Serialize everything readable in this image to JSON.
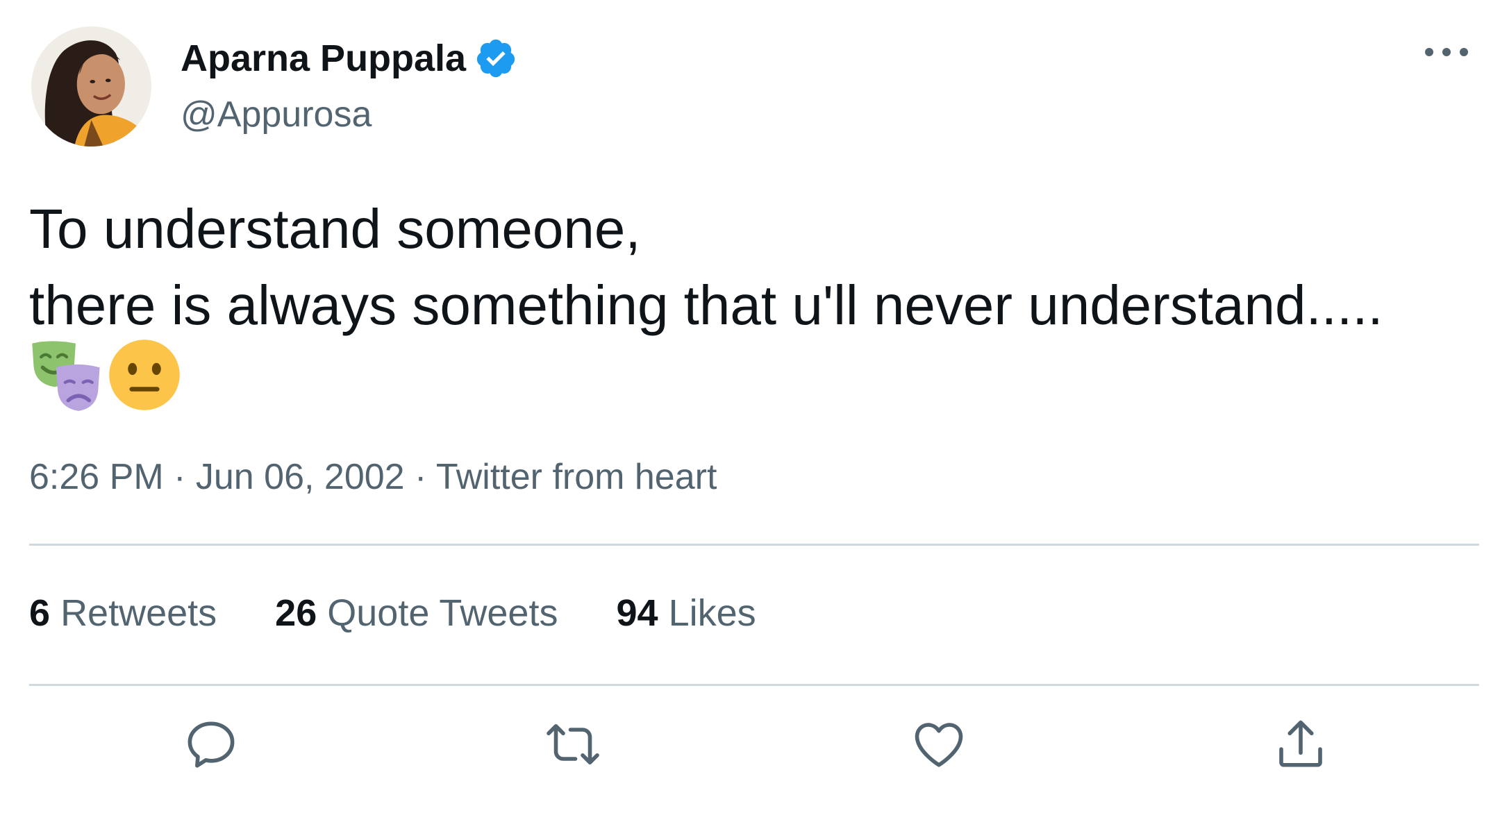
{
  "author": {
    "display_name": "Aparna Puppala",
    "handle": "@Appurosa",
    "verified": true,
    "avatar_icon": "avatar-photo"
  },
  "tweet": {
    "lines": [
      "To understand someone,",
      "there is always something that u'll never understand....."
    ],
    "emojis": [
      "performing-arts",
      "neutral-face"
    ]
  },
  "meta": {
    "time": "6:26 PM",
    "date": "Jun 06, 2002",
    "source": "Twitter from heart",
    "separator": " · "
  },
  "stats": [
    {
      "count": "6",
      "label": "Retweets"
    },
    {
      "count": "26",
      "label": "Quote Tweets"
    },
    {
      "count": "94",
      "label": "Likes"
    }
  ],
  "actions": [
    "reply-icon",
    "retweet-icon",
    "like-icon",
    "share-icon"
  ],
  "colors": {
    "text": "#0f1419",
    "secondary": "#536471",
    "divider": "#cfd9de",
    "verified": "#1d9bf0"
  }
}
